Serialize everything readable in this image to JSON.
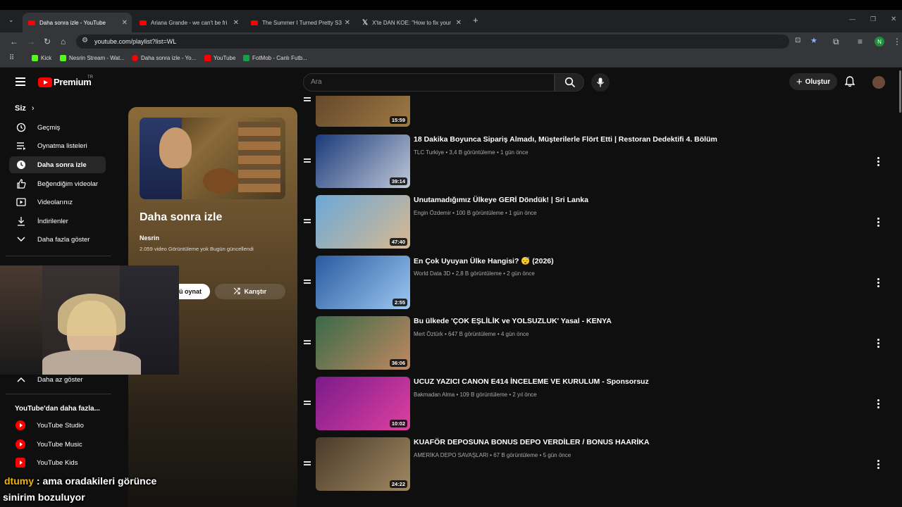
{
  "browser": {
    "tabs": [
      {
        "title": "Daha sonra izle - YouTube",
        "active": true,
        "icon": "youtube-icon"
      },
      {
        "title": "Ariana Grande - we can't be fri",
        "active": false,
        "icon": "youtube-icon"
      },
      {
        "title": "The Summer I Turned Pretty S3",
        "active": false,
        "icon": "youtube-icon"
      },
      {
        "title": "X'te DAN KOE: \"How to fix your",
        "active": false,
        "icon": "x-icon"
      }
    ],
    "new_tab_label": "+",
    "url": "youtube.com/playlist?list=WL",
    "bookmarks": [
      {
        "label": "Kick",
        "color": "#53fc18"
      },
      {
        "label": "Nesrin Stream - Wat...",
        "color": "#53fc18"
      },
      {
        "label": "Daha sonra izle - Yo...",
        "color": "#ff0000"
      },
      {
        "label": "YouTube",
        "color": "#ff0000"
      },
      {
        "label": "FotMob - Canlı Futb...",
        "color": "#14a048"
      }
    ],
    "profile_initial": "N"
  },
  "header": {
    "logo_text": "Premium",
    "logo_region": "TR",
    "search_placeholder": "Ara",
    "create_label": "Oluştur"
  },
  "sidebar": {
    "section_title": "Siz",
    "items": [
      {
        "label": "Geçmiş",
        "icon": "history-icon"
      },
      {
        "label": "Oynatma listeleri",
        "icon": "playlists-icon"
      },
      {
        "label": "Daha sonra izle",
        "icon": "clock-icon",
        "active": true
      },
      {
        "label": "Beğendiğim videolar",
        "icon": "thumbs-up-icon"
      },
      {
        "label": "Videolarınız",
        "icon": "your-videos-icon"
      },
      {
        "label": "İndirilenler",
        "icon": "download-icon"
      },
      {
        "label": "Daha fazla göster",
        "icon": "chevron-down-icon"
      }
    ],
    "show_less": "Daha az göster",
    "more_title": "YouTube'dan daha fazla...",
    "apps": [
      {
        "label": "YouTube Studio"
      },
      {
        "label": "YouTube Music"
      },
      {
        "label": "YouTube Kids"
      }
    ]
  },
  "playlist": {
    "title": "Daha sonra izle",
    "owner": "Nesrin",
    "meta": "2.059 video   Görüntüleme yok   Bugün güncellendi",
    "play_all_label": "ü oynat",
    "shuffle_label": "Karıştır"
  },
  "videos": [
    {
      "title": "",
      "meta": "",
      "duration": "15:59",
      "thumb": [
        "#5a4028",
        "#a07a44"
      ]
    },
    {
      "title": "18 Dakika Boyunca Sipariş Almadı, Müşterilerle Flört Etti | Restoran Dedektifi 4. Bölüm",
      "meta": "TLC Turkiye • 3,4 B görüntüleme • 1 gün önce",
      "duration": "39:14",
      "thumb": [
        "#1a3a7a",
        "#c0c8d8"
      ]
    },
    {
      "title": "Unutamadığımız Ülkeye GERİ Döndük! | Sri Lanka",
      "meta": "Engin Özdemir • 100 B görüntüleme • 1 gün önce",
      "duration": "47:40",
      "thumb": [
        "#6aa8d8",
        "#d8b890"
      ]
    },
    {
      "title": "En Çok Uyuyan Ülke Hangisi? 😴 (2026)",
      "meta": "World Data 3D • 2,8 B görüntüleme • 2 gün önce",
      "duration": "2:55",
      "thumb": [
        "#2a5aa0",
        "#9cc8f0"
      ]
    },
    {
      "title": "Bu ülkede 'ÇOK EŞLİLİK ve YOLSUZLUK' Yasal - KENYA",
      "meta": "Mert Öztürk • 647 B görüntüleme • 4 gün önce",
      "duration": "36:06",
      "thumb": [
        "#3a6a4a",
        "#c08860"
      ]
    },
    {
      "title": "UCUZ YAZICI CANON E414 İNCELEME VE KURULUM - Sponsorsuz",
      "meta": "Bakmadan Alma • 109 B görüntüleme • 2 yıl önce",
      "duration": "10:02",
      "thumb": [
        "#7a1a8a",
        "#e040a0"
      ]
    },
    {
      "title": "KUAFÖR DEPOSUNA BONUS DEPO VERDİLER / BONUS HAARİKA",
      "meta": "AMERİKA DEPO SAVAŞLARI • 67 B görüntüleme • 5 gün önce",
      "duration": "24:22",
      "thumb": [
        "#4a3a2a",
        "#a08860"
      ]
    }
  ],
  "chat": {
    "nick": "dtumy",
    "message": " : ama oradakileri görünce",
    "message2": "sinirim bozuluyor"
  }
}
